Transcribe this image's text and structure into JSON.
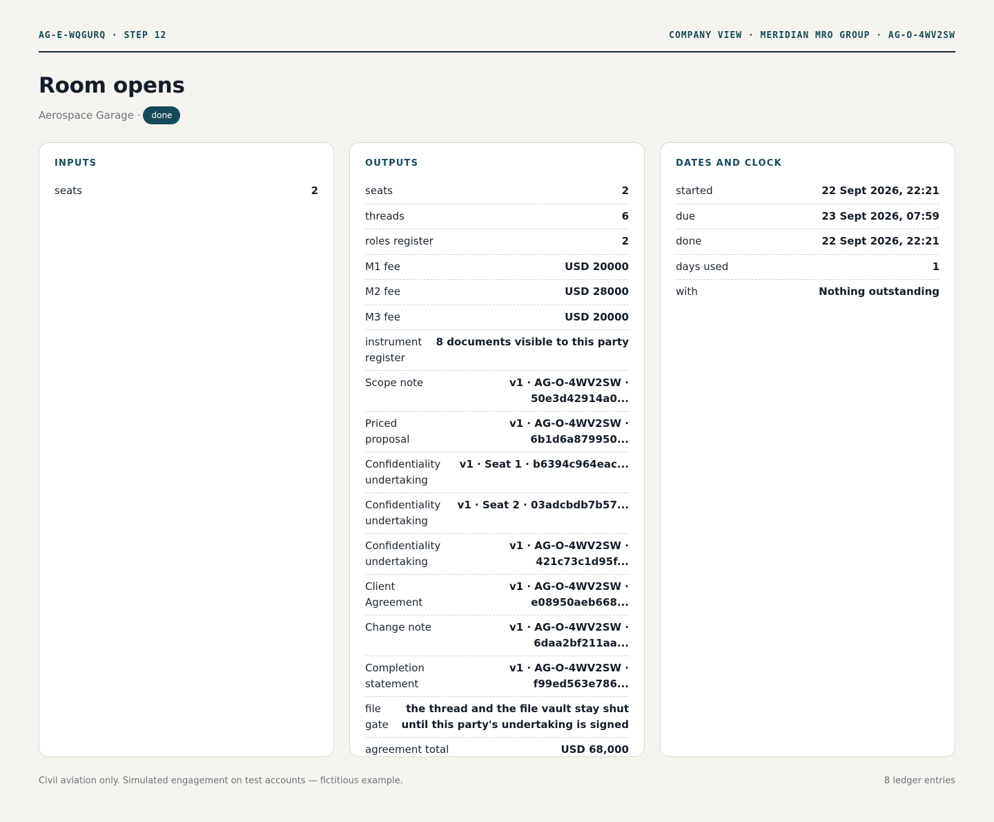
{
  "header": {
    "left": "AG-E-WQGURQ · STEP 12",
    "right": "COMPANY VIEW · MERIDIAN MRO GROUP · AG-O-4WV2SW"
  },
  "title": "Room opens",
  "subtitle": {
    "text": "Aerospace Garage ·",
    "status": "done"
  },
  "inputs": {
    "heading": "INPUTS",
    "rows": [
      {
        "k": "seats",
        "v": "2"
      }
    ]
  },
  "outputs": {
    "heading": "OUTPUTS",
    "rows": [
      {
        "k": "seats",
        "v": "2"
      },
      {
        "k": "threads",
        "v": "6"
      },
      {
        "k": "roles register",
        "v": "2"
      },
      {
        "k": "M1 fee",
        "v": "USD 20000"
      },
      {
        "k": "M2 fee",
        "v": "USD 28000"
      },
      {
        "k": "M3 fee",
        "v": "USD 20000"
      },
      {
        "k": "instrument register",
        "v": "8 documents visible to this party"
      },
      {
        "k": "Scope note",
        "v": "v1 · AG-O-4WV2SW · 50e3d42914a0..."
      },
      {
        "k": "Priced proposal",
        "v": "v1 · AG-O-4WV2SW · 6b1d6a879950..."
      },
      {
        "k": "Confidentiality undertaking",
        "v": "v1 · Seat 1 · b6394c964eac..."
      },
      {
        "k": "Confidentiality undertaking",
        "v": "v1 · Seat 2 · 03adcbdb7b57..."
      },
      {
        "k": "Confidentiality undertaking",
        "v": "v1 · AG-O-4WV2SW · 421c73c1d95f..."
      },
      {
        "k": "Client Agreement",
        "v": "v1 · AG-O-4WV2SW · e08950aeb668..."
      },
      {
        "k": "Change note",
        "v": "v1 · AG-O-4WV2SW · 6daa2bf211aa..."
      },
      {
        "k": "Completion statement",
        "v": "v1 · AG-O-4WV2SW · f99ed563e786..."
      },
      {
        "k": "file gate",
        "v": "the thread and the file vault stay shut until this party's undertaking is signed"
      },
      {
        "k": "agreement total",
        "v": "USD 68,000"
      }
    ]
  },
  "dates": {
    "heading": "DATES AND CLOCK",
    "rows": [
      {
        "k": "started",
        "v": "22 Sept 2026, 22:21"
      },
      {
        "k": "due",
        "v": "23 Sept 2026, 07:59"
      },
      {
        "k": "done",
        "v": "22 Sept 2026, 22:21"
      },
      {
        "k": "days used",
        "v": "1"
      },
      {
        "k": "with",
        "v": "Nothing outstanding"
      }
    ]
  },
  "footer": {
    "left": "Civil aviation only. Simulated engagement on test accounts — fictitious example.",
    "right": "8 ledger entries"
  }
}
